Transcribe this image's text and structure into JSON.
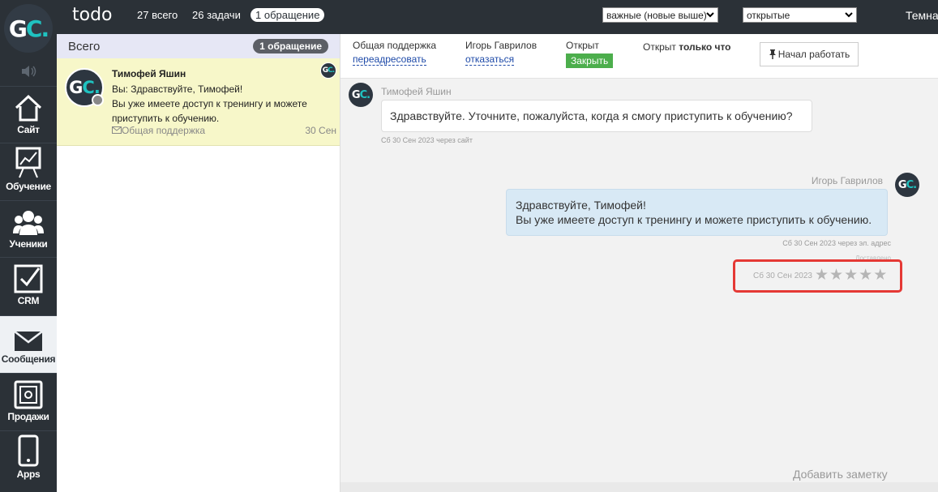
{
  "app": {
    "logo_letters": [
      "G",
      "C."
    ],
    "title": "todo"
  },
  "topbar": {
    "count_total": "27 всего",
    "count_tasks": "26 задачи",
    "count_open": "1 обращение",
    "sort_select": {
      "value": "важные (новые выше)"
    },
    "status_select": {
      "value": "открытые"
    },
    "theme_label": "Темна"
  },
  "sidebar": {
    "items": [
      {
        "label": "Сайт",
        "icon": "home-icon"
      },
      {
        "label": "Обучение",
        "icon": "presentation-icon"
      },
      {
        "label": "Ученики",
        "icon": "users-icon"
      },
      {
        "label": "CRM",
        "icon": "checkbox-icon"
      },
      {
        "label": "Сообщения",
        "icon": "envelope-icon",
        "active": true
      },
      {
        "label": "Продажи",
        "icon": "safe-icon"
      },
      {
        "label": "Apps",
        "icon": "phone-icon"
      }
    ]
  },
  "list": {
    "title": "Всего",
    "badge": "1 обращение",
    "ticket": {
      "name": "Тимофей Яшин",
      "preview": "Вы: Здравствуйте, Тимофей!\nВы уже имеете доступ к тренингу и можете приступить к обучению.",
      "category": "Общая поддержка",
      "date": "30 Сен"
    }
  },
  "detail": {
    "category_label": "Общая поддержка",
    "redirect_link": "переадресовать",
    "assignee_label": "Игорь Гаврилов",
    "refuse_link": "отказаться",
    "status_label": "Открыт",
    "close_button": "Закрыть",
    "opened_prefix": "Открыт",
    "opened_when": "только что",
    "start_button": "Начал работать",
    "messages": [
      {
        "author": "Тимофей Яшин",
        "text": "Здравствуйте. Уточните, пожалуйста, когда я смогу приступить к обучению?",
        "meta": "Сб 30 Сен 2023 через сайт"
      },
      {
        "author": "Игорь Гаврилов",
        "text_line1": "Здравствуйте, Тимофей!",
        "text_line2": "Вы уже имеете доступ к тренингу и можете приступить к обучению.",
        "meta": "Сб 30 Сен 2023 через эл. адрес",
        "extra": "Доставлено"
      }
    ],
    "rating": {
      "date": "Сб 30 Сен 2023",
      "stars_total": 5,
      "stars_filled": 0
    },
    "add_note": "Добавить заметку"
  },
  "colors": {
    "dark_bg": "#2b3137",
    "logo_accent": "#1fc2c0",
    "selected_ticket": "#f7f7c9",
    "agent_bubble": "#d8e9f5",
    "close_green": "#4cae4c",
    "highlight_red": "#e53935"
  }
}
